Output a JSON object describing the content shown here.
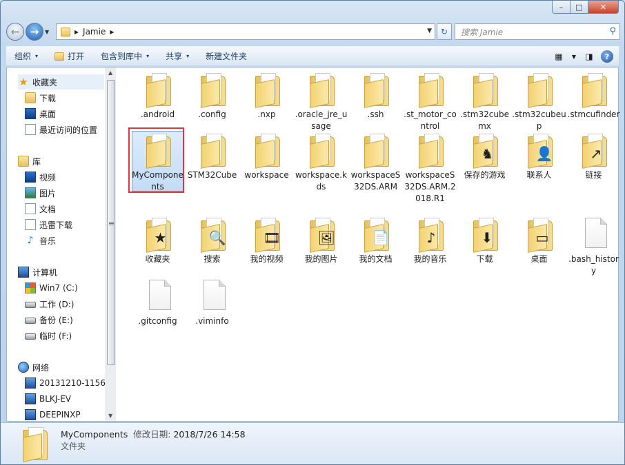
{
  "window": {
    "min": "–",
    "max": "□",
    "close": "✕"
  },
  "address": {
    "segment_sep": "▸",
    "folder": "Jamie",
    "search_placeholder": "搜索 Jamie"
  },
  "commands": [
    {
      "label": "组织",
      "arrow": "▾"
    },
    {
      "label": "打开",
      "arrow": ""
    },
    {
      "label": "包含到库中",
      "arrow": "▾"
    },
    {
      "label": "共享",
      "arrow": "▾"
    },
    {
      "label": "新建文件夹",
      "arrow": ""
    }
  ],
  "tree": {
    "favorites": {
      "label": "收藏夹",
      "items": [
        "下载",
        "桌面",
        "最近访问的位置"
      ]
    },
    "libraries": {
      "label": "库",
      "items": [
        "视频",
        "图片",
        "文档",
        "迅雷下载",
        "音乐"
      ]
    },
    "computer": {
      "label": "计算机",
      "items": [
        "Win7 (C:)",
        "工作 (D:)",
        "备份 (E:)",
        "临时 (F:)"
      ]
    },
    "network": {
      "label": "网络",
      "items": [
        "20131210-1156",
        "BLKJ-EV",
        "DEEPINXP"
      ]
    }
  },
  "files": [
    {
      "name": ".android",
      "kind": "folder"
    },
    {
      "name": ".config",
      "kind": "folder"
    },
    {
      "name": ".nxp",
      "kind": "folder"
    },
    {
      "name": ".oracle_jre_usage",
      "kind": "folder"
    },
    {
      "name": ".ssh",
      "kind": "folder"
    },
    {
      "name": ".st_motor_control",
      "kind": "folder"
    },
    {
      "name": ".stm32cubemx",
      "kind": "folder"
    },
    {
      "name": ".stm32cubeup",
      "kind": "folder"
    },
    {
      "name": ".stmcufinder",
      "kind": "folder"
    },
    {
      "name": "MyComponents",
      "kind": "folder",
      "selected": true
    },
    {
      "name": "STM32Cube",
      "kind": "folder"
    },
    {
      "name": "workspace",
      "kind": "folder"
    },
    {
      "name": "workspace.kds",
      "kind": "folder"
    },
    {
      "name": "workspaceS32DS.ARM",
      "kind": "folder"
    },
    {
      "name": "workspaceS32DS.ARM.2018.R1",
      "kind": "folder"
    },
    {
      "name": "保存的游戏",
      "kind": "special",
      "badge": "♞"
    },
    {
      "name": "联系人",
      "kind": "special",
      "badge": "👤"
    },
    {
      "name": "链接",
      "kind": "special",
      "badge": "↗"
    },
    {
      "name": "收藏夹",
      "kind": "special",
      "badge": "★"
    },
    {
      "name": "搜索",
      "kind": "special",
      "badge": "🔍"
    },
    {
      "name": "我的视频",
      "kind": "special",
      "badge": "🎞"
    },
    {
      "name": "我的图片",
      "kind": "special",
      "badge": "🖼"
    },
    {
      "name": "我的文档",
      "kind": "special",
      "badge": "📄"
    },
    {
      "name": "我的音乐",
      "kind": "special",
      "badge": "♪"
    },
    {
      "name": "下载",
      "kind": "special",
      "badge": "⬇"
    },
    {
      "name": "桌面",
      "kind": "special",
      "badge": "▭"
    },
    {
      "name": ".bash_history",
      "kind": "file"
    },
    {
      "name": ".gitconfig",
      "kind": "file"
    },
    {
      "name": ".viminfo",
      "kind": "file"
    }
  ],
  "details": {
    "name": "MyComponents",
    "date_label": "修改日期:",
    "date": "2018/7/26 14:58",
    "type": "文件夹"
  },
  "colors": {
    "selection_border": "#e0353a",
    "selection_fill": "#c3dcf6",
    "folder_yellow": "#f3d273"
  }
}
